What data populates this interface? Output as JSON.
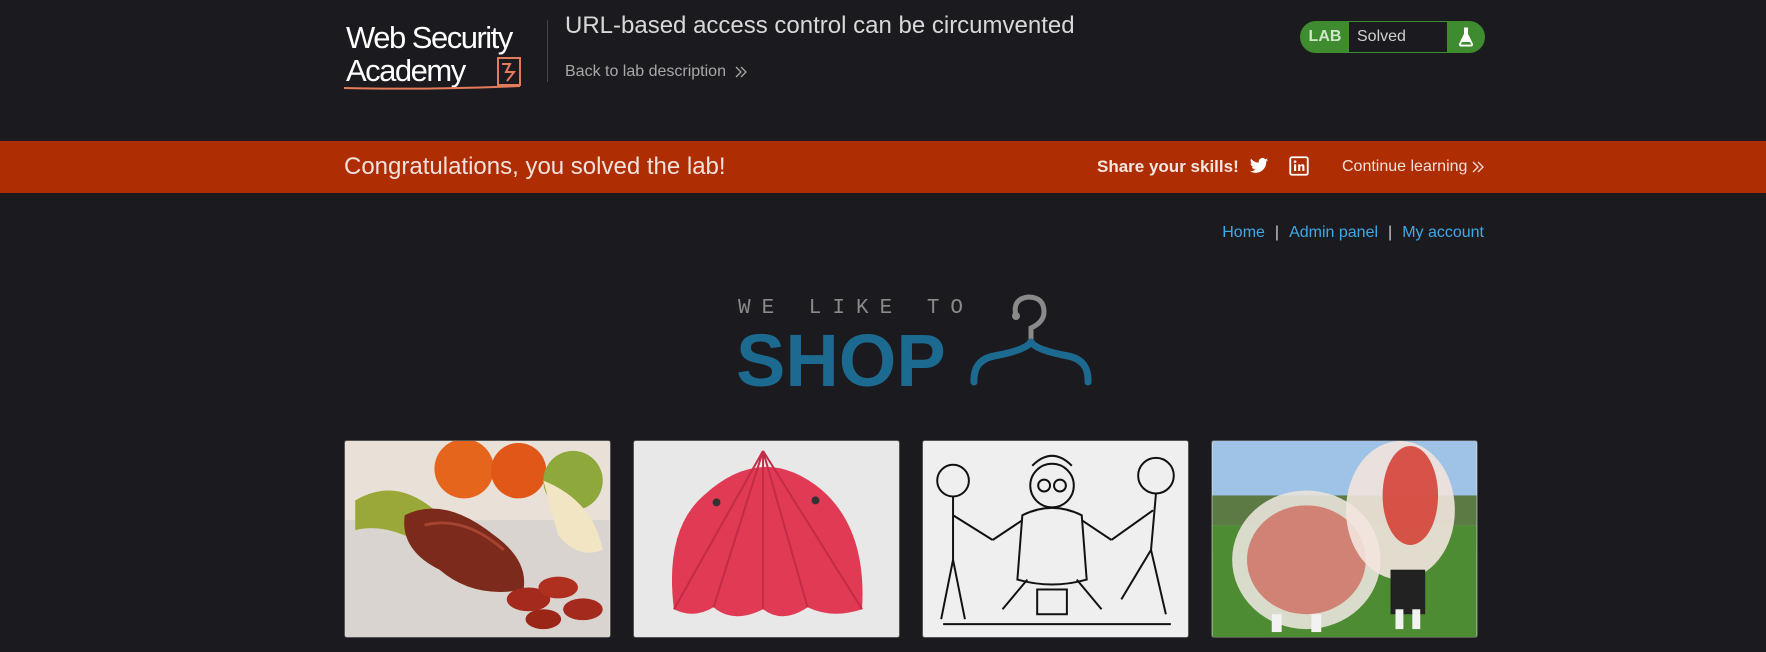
{
  "header": {
    "logo_text_line1": "Web Security",
    "logo_text_line2": "Academy",
    "lab_title": "URL-based access control can be circumvented",
    "back_link_label": "Back to lab description",
    "lab_badge": "LAB",
    "lab_status": "Solved",
    "lab_status_color": "#3e8c2f"
  },
  "banner": {
    "message": "Congratulations, you solved the lab!",
    "share_label": "Share your skills!",
    "share_icons": [
      "twitter-icon",
      "linkedin-icon"
    ],
    "continue_label": "Continue learning",
    "background_color": "#ae2d02"
  },
  "nav": {
    "items": [
      "Home",
      "Admin panel",
      "My account"
    ],
    "separator": "|",
    "link_color": "#3fa9e6"
  },
  "shop_logo": {
    "tagline": "WE LIKE TO",
    "word": "SHOP",
    "icon": "hanger-icon",
    "color": "#1c6a8f"
  },
  "products": [
    {
      "image": "sausage-and-fruit"
    },
    {
      "image": "red-umbrella"
    },
    {
      "image": "cartoon-tug-of-war"
    },
    {
      "image": "bubble-football"
    }
  ]
}
